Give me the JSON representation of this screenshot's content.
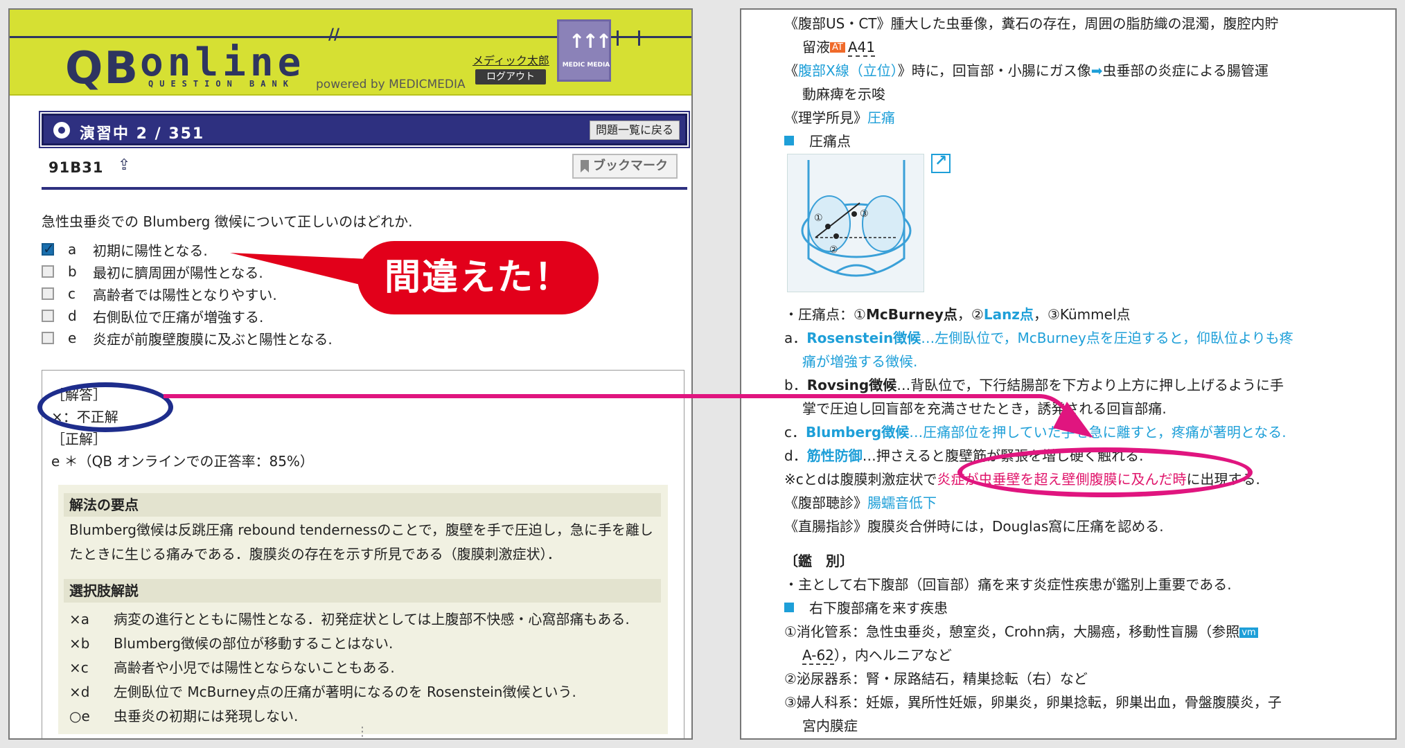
{
  "left": {
    "logo_q": "QB",
    "logo_online": "online",
    "logo_sub": "QUESTION BANK",
    "powered": "powered by MEDICMEDIA",
    "user_name": "メディック太郎",
    "logout": "ログアウト",
    "mm_logo_text": "MEDIC MEDIA",
    "status": "演習中 2 / 351",
    "back_to_list": "問題一覧に戻る",
    "question_id": "91B31",
    "bookmark": "ブックマーク",
    "question": "急性虫垂炎での Blumberg 徴候について正しいのはどれか.",
    "choices": [
      {
        "letter": "a",
        "text": "初期に陽性となる.",
        "checked": true
      },
      {
        "letter": "b",
        "text": "最初に臍周囲が陽性となる.",
        "checked": false
      },
      {
        "letter": "c",
        "text": "高齢者では陽性となりやすい.",
        "checked": false
      },
      {
        "letter": "d",
        "text": "右側臥位で圧痛が増強する.",
        "checked": false
      },
      {
        "letter": "e",
        "text": "炎症が前腹壁腹膜に及ぶと陽性となる.",
        "checked": false
      }
    ],
    "callout": "間違えた！",
    "answer_label": "［解答］",
    "answer_value": "×：不正解",
    "correct_label": "［正解］",
    "correct_value": "e ＊（QB オンラインでの正答率：85%）",
    "points_heading": "解法の要点",
    "points_text": "Blumberg徴候は反跳圧痛 rebound tendernessのことで，腹壁を手で圧迫し，急に手を離したときに生じる痛みである．腹膜炎の存在を示す所見である（腹膜刺激症状）．",
    "choices_heading": "選択肢解説",
    "explanations": [
      {
        "mark": "×a",
        "text": "病変の進行とともに陽性となる．初発症状としては上腹部不快感・心窩部痛もある."
      },
      {
        "mark": "×b",
        "text": "Blumberg徴候の部位が移動することはない."
      },
      {
        "mark": "×c",
        "text": "高齢者や小児では陽性とならないこともある."
      },
      {
        "mark": "×d",
        "text": "左側臥位で McBurney点の圧痛が著明になるのを Rosenstein徴候という."
      },
      {
        "mark": "○e",
        "text": "虫垂炎の初期には発現しない."
      }
    ]
  },
  "right": {
    "l1": "《腹部US・CT》腫大した虫垂像，糞石の存在，周囲の脂肪織の混濁，腹腔内貯",
    "l2a": "留液",
    "l2_badge": "AT",
    "l2b": "A41",
    "l3a": "《",
    "l3b": "腹部X線（立位）",
    "l3c": "》時に，回盲部・小腸にガス像",
    "l3d": "➡",
    "l3e": "虫垂部の炎症による腸管運",
    "l4": "動麻痺を示唆",
    "l5a": "《理学所見》",
    "l5b": "圧痛",
    "l6": "圧痛点",
    "fig_labels": [
      "①",
      "②",
      "③"
    ],
    "l7a": "・圧痛点：①",
    "l7b": "McBurney点",
    "l7c": "，②",
    "l7d": "Lanz点",
    "l7e": "，③Kümmel点",
    "l8a": "a．",
    "l8b": "Rosenstein徴候",
    "l8c": "…左側臥位で，McBurney点を圧迫すると，仰臥位よりも疼",
    "l9": "痛が増強する徴候.",
    "l10a": "b．",
    "l10b": "Rovsing徴候",
    "l10c": "…背臥位で，下行結腸部を下方より上方に押し上げるように手",
    "l11": "掌で圧迫し回盲部を充満させたとき，誘発される回盲部痛.",
    "l12a": "c．",
    "l12b": "Blumberg徴候",
    "l12c": "…圧痛部位を押していた手を急に離すと，疼痛が著明となる.",
    "l13a": "d．",
    "l13b": "筋性防御",
    "l13c": "…押さえると腹壁筋が緊張を増し硬く触れる.",
    "l14a": "※cとdは腹膜刺激症状で",
    "l14b": "炎症が虫垂壁を超え壁側腹膜に及んだ時",
    "l14c": "に出現する.",
    "l15a": "《腹部聴診》",
    "l15b": "腸蠕音低下",
    "l16": "《直腸指診》腹膜炎合併時には，Douglas窩に圧痛を認める.",
    "l17": "〔鑑　別〕",
    "l18": "・主として右下腹部（回盲部）痛を来す炎症性疾患が鑑別上重要である.",
    "l19": "右下腹部痛を来す疾患",
    "l20a": "①消化管系：急性虫垂炎，憩室炎，Crohn病，大腸癌，移動性盲腸（参照",
    "l20_badge": "vm",
    "l21a": "A-62",
    "l21b": "），内ヘルニアなど",
    "l22": "②泌尿器系：腎・尿路結石，精巣捻転（右）など",
    "l23": "③婦人科系：妊娠，異所性妊娠，卵巣炎，卵巣捻転，卵巣出血，骨盤腹膜炎，子",
    "l24": "宮内膜症"
  },
  "colors": {
    "banner": "#d6e033",
    "navy": "#2e3080",
    "callout_red": "#e2001a",
    "arrow_pink": "#e0157f",
    "link_cyan": "#1e9fd8"
  }
}
